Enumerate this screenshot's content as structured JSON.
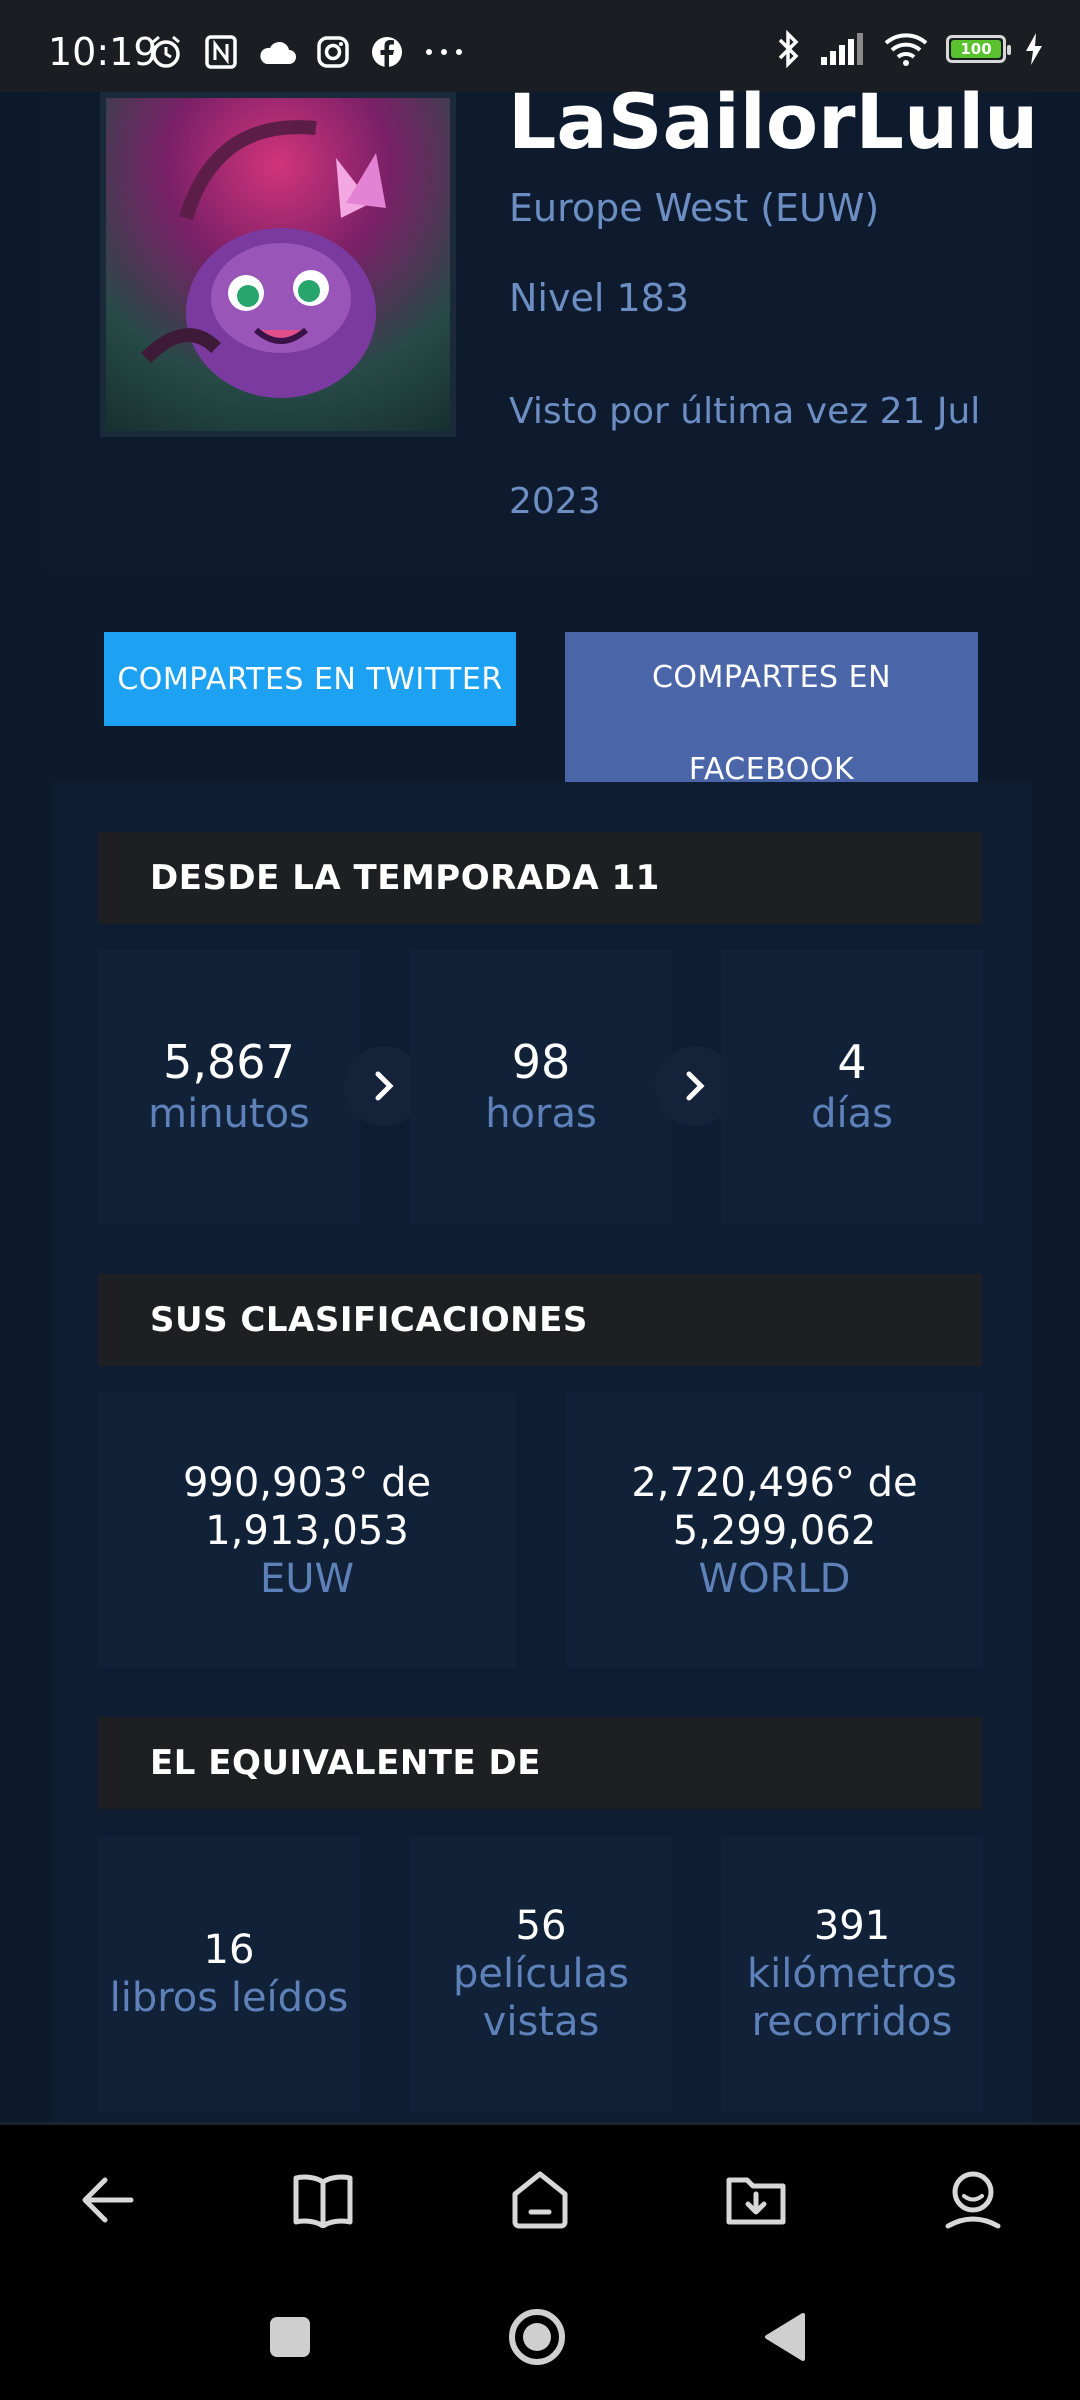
{
  "status_bar": {
    "time": "10:19",
    "battery": "100",
    "icons_left": [
      "alarm-icon",
      "nfc-icon",
      "cloud-icon",
      "instagram-icon",
      "facebook-icon",
      "more-icon"
    ],
    "icons_right": [
      "bluetooth-icon",
      "signal-icon",
      "wifi-icon",
      "battery-icon",
      "charging-icon"
    ]
  },
  "profile": {
    "name": "LaSailorLulu",
    "region": "Europe West (EUW)",
    "level": "Nivel 183",
    "last_seen": "Visto por última vez 21 Jul 2023"
  },
  "share": {
    "twitter": "COMPARTES EN TWITTER",
    "facebook": "COMPARTES EN FACEBOOK"
  },
  "season": {
    "title": "DESDE LA TEMPORADA 11",
    "items": [
      {
        "value": "5,867",
        "unit": "minutos"
      },
      {
        "value": "98",
        "unit": "horas"
      },
      {
        "value": "4",
        "unit": "días"
      }
    ]
  },
  "rankings": {
    "title": "SUS CLASIFICACIONES",
    "items": [
      {
        "line1": "990,903° de",
        "line2": "1,913,053",
        "scope": "EUW"
      },
      {
        "line1": "2,720,496° de",
        "line2": "5,299,062",
        "scope": "WORLD"
      }
    ]
  },
  "equivalent": {
    "title": "EL EQUIVALENTE DE",
    "items": [
      {
        "value": "16",
        "unit": "libros leídos"
      },
      {
        "value": "56",
        "unit": "películas vistas"
      },
      {
        "value": "391",
        "unit": "kilómetros recorridos"
      }
    ]
  },
  "app_nav": [
    "back-icon",
    "book-icon",
    "home-icon",
    "download-folder-icon",
    "profile-icon"
  ],
  "system_nav": [
    "recent-apps-icon",
    "home-circle-icon",
    "back-triangle-icon"
  ],
  "colors": {
    "background": "#0d1a2b",
    "accent_text": "#6d8ec3",
    "twitter": "#1da1f2",
    "facebook": "#4a65a8",
    "section_header": "#1e1f22"
  }
}
